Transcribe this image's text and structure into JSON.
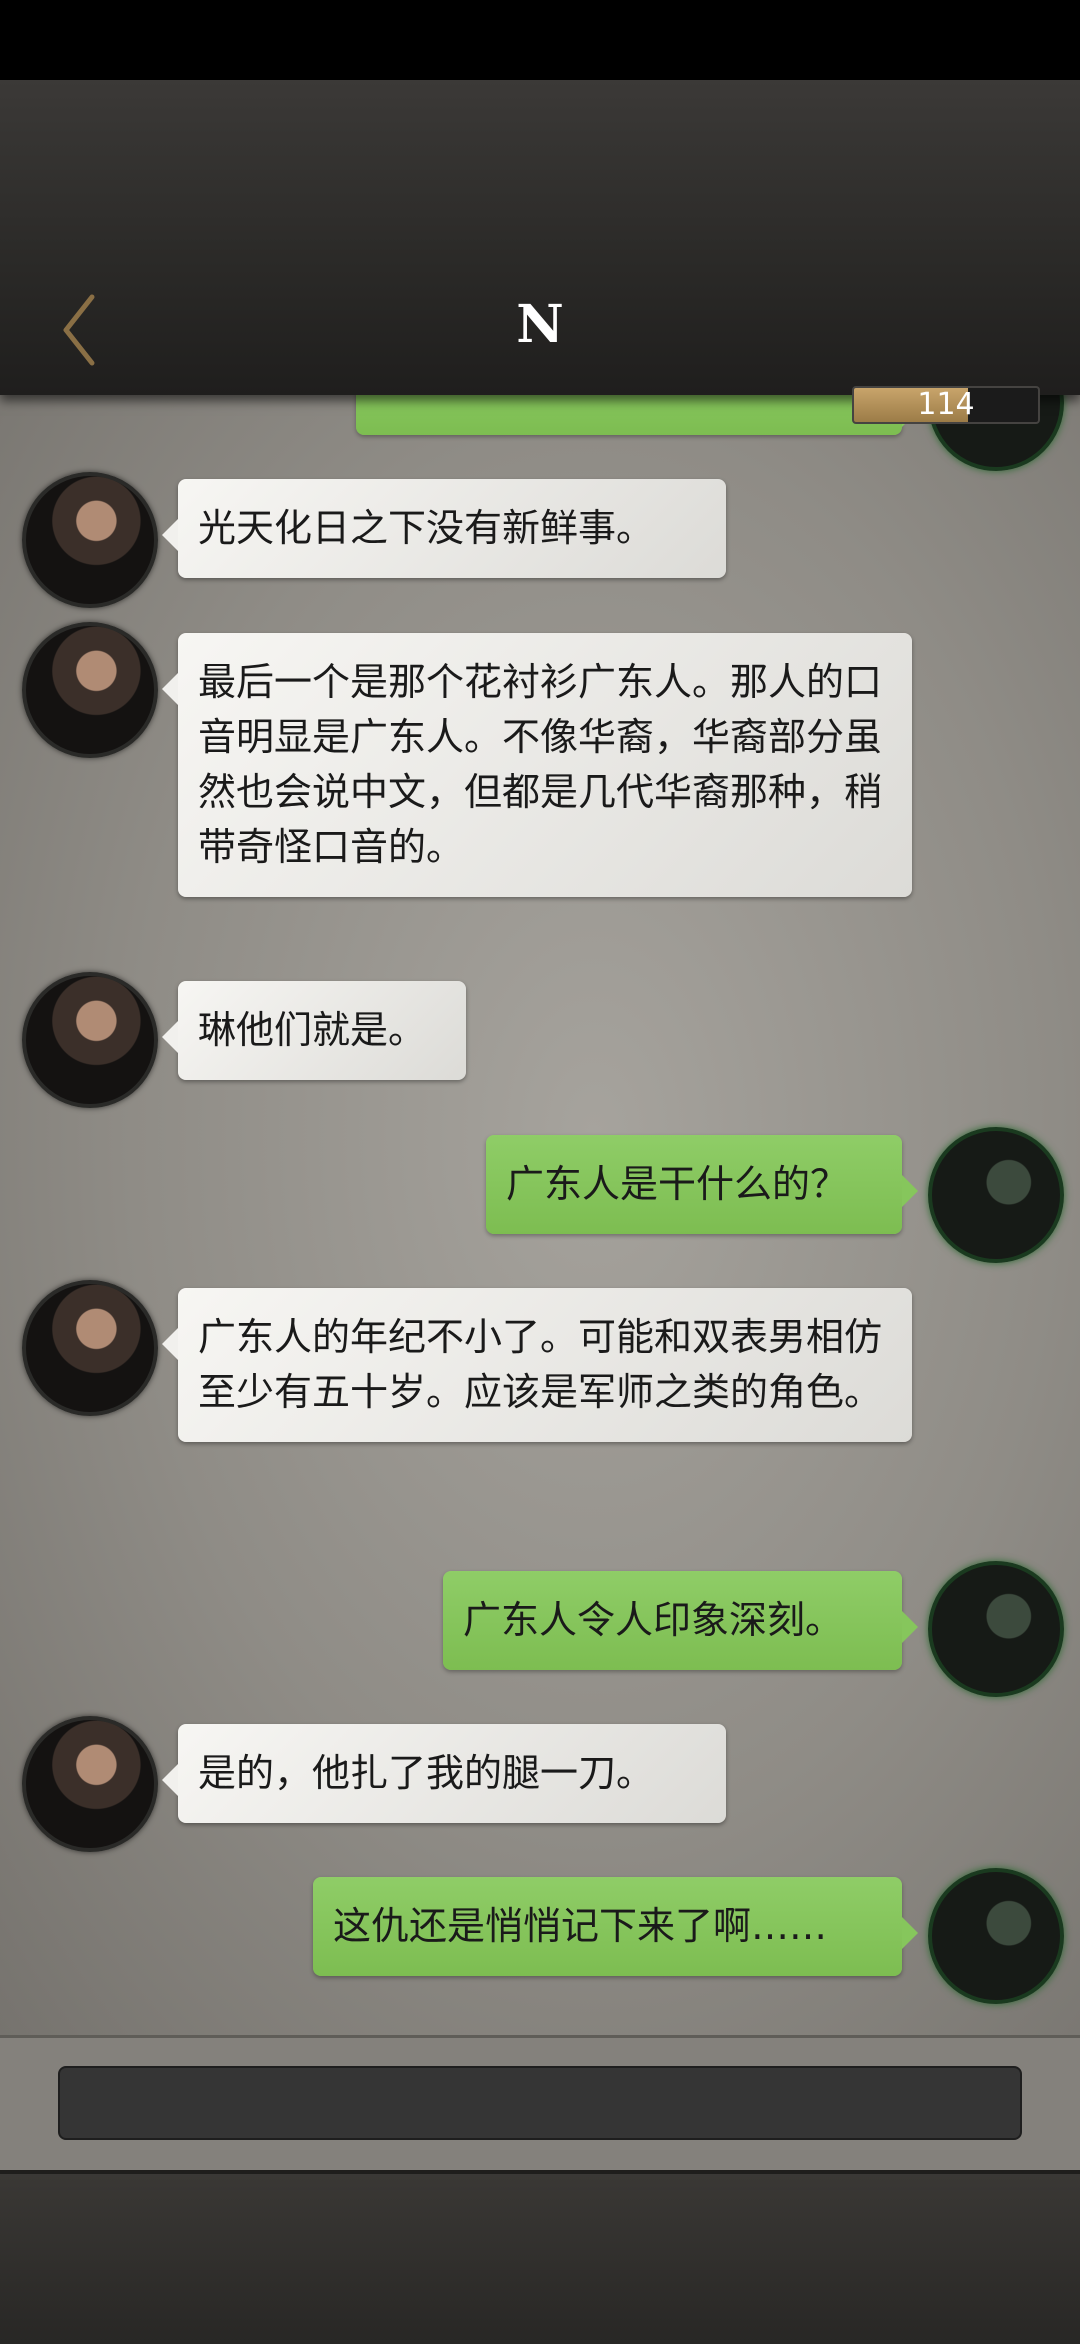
{
  "header": {
    "title": "N",
    "back_icon": "chevron-left-icon",
    "counter_value": "114",
    "counter_fill_fraction": 0.62,
    "accent_color": "#c8a46b"
  },
  "messages": [
    {
      "side": "right",
      "text": "",
      "partial": true
    },
    {
      "side": "left",
      "text": "光天化日之下没有新鲜事。"
    },
    {
      "side": "left",
      "text": "最后一个是那个花衬衫广东人。那人的口音明显是广东人。不像华裔，华裔部分虽然也会说中文，但都是几代华裔那种，稍带奇怪口音的。"
    },
    {
      "side": "left",
      "text": "琳他们就是。"
    },
    {
      "side": "right",
      "text": "广东人是干什么的？"
    },
    {
      "side": "left",
      "text": "广东人的年纪不小了。可能和双表男相仿至少有五十岁。应该是军师之类的角色。"
    },
    {
      "side": "right",
      "text": "广东人令人印象深刻。"
    },
    {
      "side": "left",
      "text": "是的，他扎了我的腿一刀。"
    },
    {
      "side": "right",
      "text": "这仇还是悄悄记下来了啊……"
    }
  ],
  "colors": {
    "bubble_left": "#f2f1ee",
    "bubble_right": "#86c65c",
    "header_bg": "#2a2927"
  }
}
